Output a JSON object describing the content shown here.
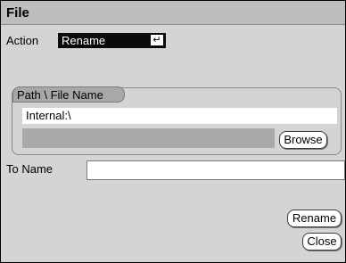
{
  "window": {
    "title": "File"
  },
  "action": {
    "label": "Action",
    "selected": "Rename",
    "enter_glyph": "↵"
  },
  "path_group": {
    "title": "Path \\ File Name",
    "path_value": "Internal:\\",
    "browse_label": "Browse"
  },
  "to_name": {
    "label": "To Name",
    "value": ""
  },
  "buttons": {
    "rename_label": "Rename",
    "close_label": "Close"
  },
  "colors": {
    "background": "#d4d4d4",
    "titlebar": "#bdbdbd",
    "dropdown_bg": "#0a0a0a",
    "group_tab": "#a8a8a8",
    "grey_field": "#a9a9a9"
  }
}
